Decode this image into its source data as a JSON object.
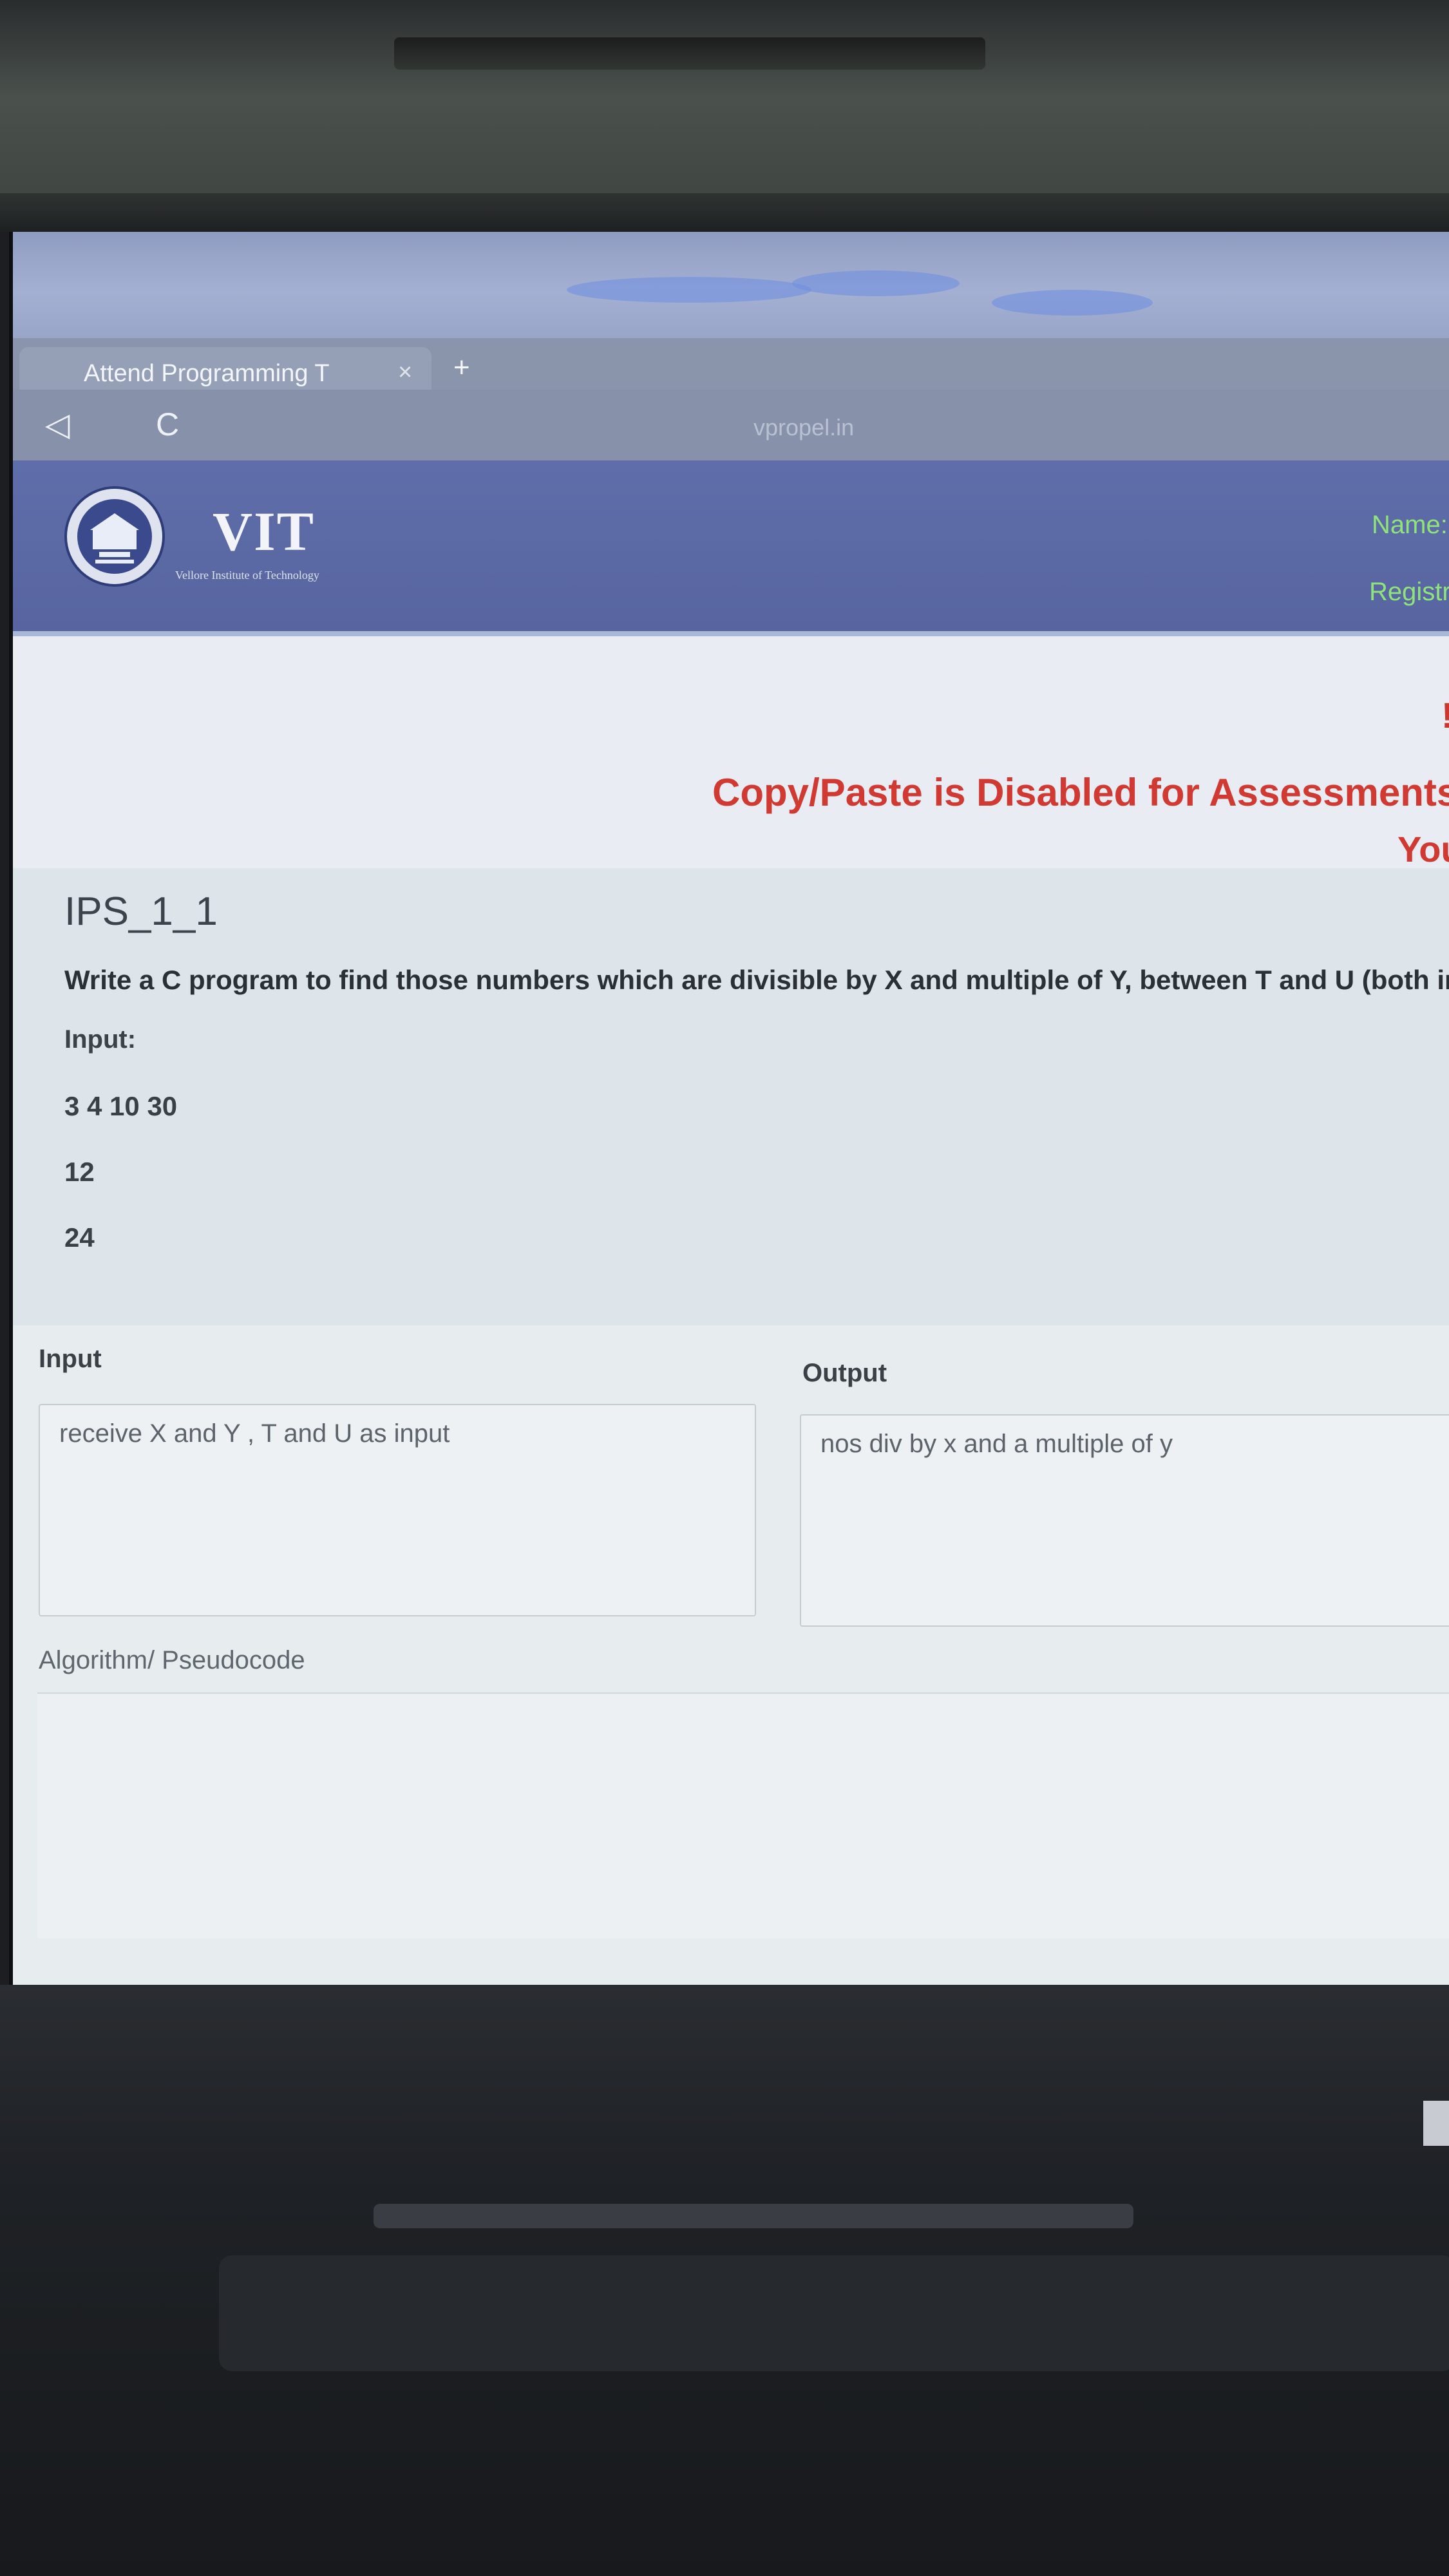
{
  "browser": {
    "tab_title": "Attend Programming T",
    "tab_close": "×",
    "new_tab": "+",
    "back_icon": "◁",
    "reload_icon": "C",
    "url": "vpropel.in"
  },
  "header": {
    "brand": "VIT",
    "brand_subtitle": "Vellore Institute of Technology",
    "name_label": "Name: ",
    "registration_label": "Registra"
  },
  "notice": {
    "exclamation": "!",
    "line1": "Copy/Paste is Disabled for Assessments.",
    "line2": "You"
  },
  "question": {
    "title": "IPS_1_1",
    "text": "Write a C program to find those numbers which are divisible by X and multiple of Y, between T and U (both included).",
    "input_label": "Input:",
    "input_lines": [
      "3 4 10 30",
      "12",
      "24"
    ]
  },
  "response": {
    "input_label": "Input",
    "input_value": "receive X and Y , T and U as input",
    "output_label": "Output",
    "output_value": "nos div by x and a  multiple of y",
    "algorithm_label": "Algorithm/ Pseudocode",
    "algorithm_value": ""
  },
  "colors": {
    "header_bg": "#5f6eaa",
    "warning_red": "#d13a32",
    "user_info_green": "#8fe37a"
  }
}
